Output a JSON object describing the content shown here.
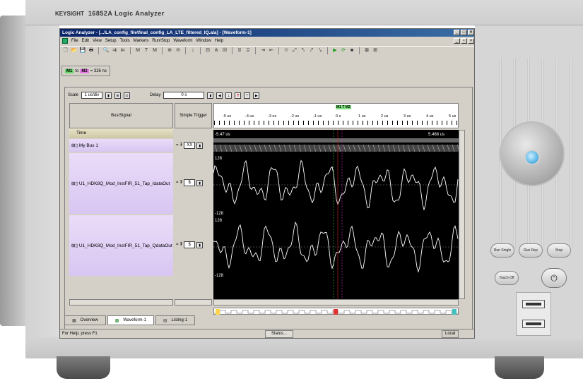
{
  "hardware": {
    "brand": "KEYSIGHT",
    "model": "16852A  Logic Analyzer",
    "buttons": {
      "run_single": "Run Single",
      "run_rep": "Run Rep",
      "stop": "Stop",
      "touch_off": "Touch Off"
    },
    "power_glyph": "⏻"
  },
  "app": {
    "title": "Logic Analyzer - [...\\LA_config_file\\final_config_LA_LTE_filtered_IQ.ala] - [Waveform-1]",
    "title_controls": [
      "_",
      "□",
      "×"
    ],
    "menus": [
      "File",
      "Edit",
      "View",
      "Setup",
      "Tools",
      "Markers",
      "Run/Stop",
      "Waveform",
      "Window",
      "Help"
    ],
    "doc_controls": [
      "_",
      "▫",
      "×"
    ],
    "toolbar_icons": [
      "new-icon",
      "open-icon",
      "save-icon",
      "print-icon",
      "find-icon",
      "find-next-icon",
      "find-prev-icon",
      "marker-icon",
      "trigger-icon",
      "mark-icon",
      "zoom-in-icon",
      "zoom-out-icon",
      "cursor-icon",
      "insert-icon",
      "bus-icon",
      "delete-icon",
      "group-icon",
      "ungroup-icon",
      "expand-icon",
      "collapse-icon",
      "filter-icon",
      "edge-icon",
      "edge2-icon",
      "edge3-icon",
      "edge4-icon",
      "run-icon",
      "repeat-icon",
      "stop-icon",
      "stop-all-icon",
      "grid-icon"
    ],
    "toolbar_glyphs": [
      "🗋",
      "📂",
      "💾",
      "🖶",
      "🔍",
      "⇉",
      "⇇",
      "M",
      "T",
      "M",
      "⊕",
      "⊖",
      "↕",
      "⊟",
      "⋔",
      "☒",
      "⌸",
      "⌹",
      "⇥",
      "⇤",
      "⟐",
      "⤢",
      "⤣",
      "⤤",
      "⤥",
      "▶",
      "⟳",
      "■",
      "⊠",
      "⊞"
    ]
  },
  "markers": {
    "m1": "M1",
    "to": "to",
    "m2": "M2",
    "value": "= 326 ns"
  },
  "waveform": {
    "scale_label": "Scale",
    "scale_value": "1 us/div",
    "delay_label": "Delay",
    "delay_value": "0 s",
    "col_bus": "Bus/Signal",
    "col_trigger": "Simple Trigger",
    "time_row": "Time",
    "ruler_marks": [
      "-5 us",
      "-4 us",
      "-3 us",
      "-2 us",
      "-1 us",
      "0 s",
      "1 us",
      "2 us",
      "3 us",
      "4 us",
      "5 us"
    ],
    "time_start": "-5.47 us",
    "time_end": "5.468 us",
    "marker_tag": "M1 T M2",
    "signals": [
      {
        "name": "My Bus 1",
        "op": "=",
        "base": "₮",
        "value": "XX"
      },
      {
        "name": "U1_HDK8Q_Mod_InstFIR_51_Tap_IdataOut",
        "op": "=",
        "base": "₮",
        "value": "$",
        "max": "128",
        "min": "-128"
      },
      {
        "name": "U1_HDK8Q_Mod_InstFIR_51_Tap_QdataOut",
        "op": "=",
        "base": "₮",
        "value": "$",
        "max": "128",
        "min": "-128"
      }
    ]
  },
  "tabs": [
    {
      "label": "Overview",
      "icon": "overview-icon",
      "active": false
    },
    {
      "label": "Waveform-1",
      "icon": "waveform-icon",
      "active": true
    },
    {
      "label": "Listing-1",
      "icon": "listing-icon",
      "active": false
    }
  ],
  "status": {
    "help": "For Help, press F1",
    "status_btn": "Status...",
    "mode": "Local"
  },
  "colors": {
    "trace": "#ffffff",
    "plot_bg": "#000000",
    "signal_bg": "#d8c6f2",
    "marker_green": "#33cc33",
    "marker_magenta": "#cc33cc"
  }
}
